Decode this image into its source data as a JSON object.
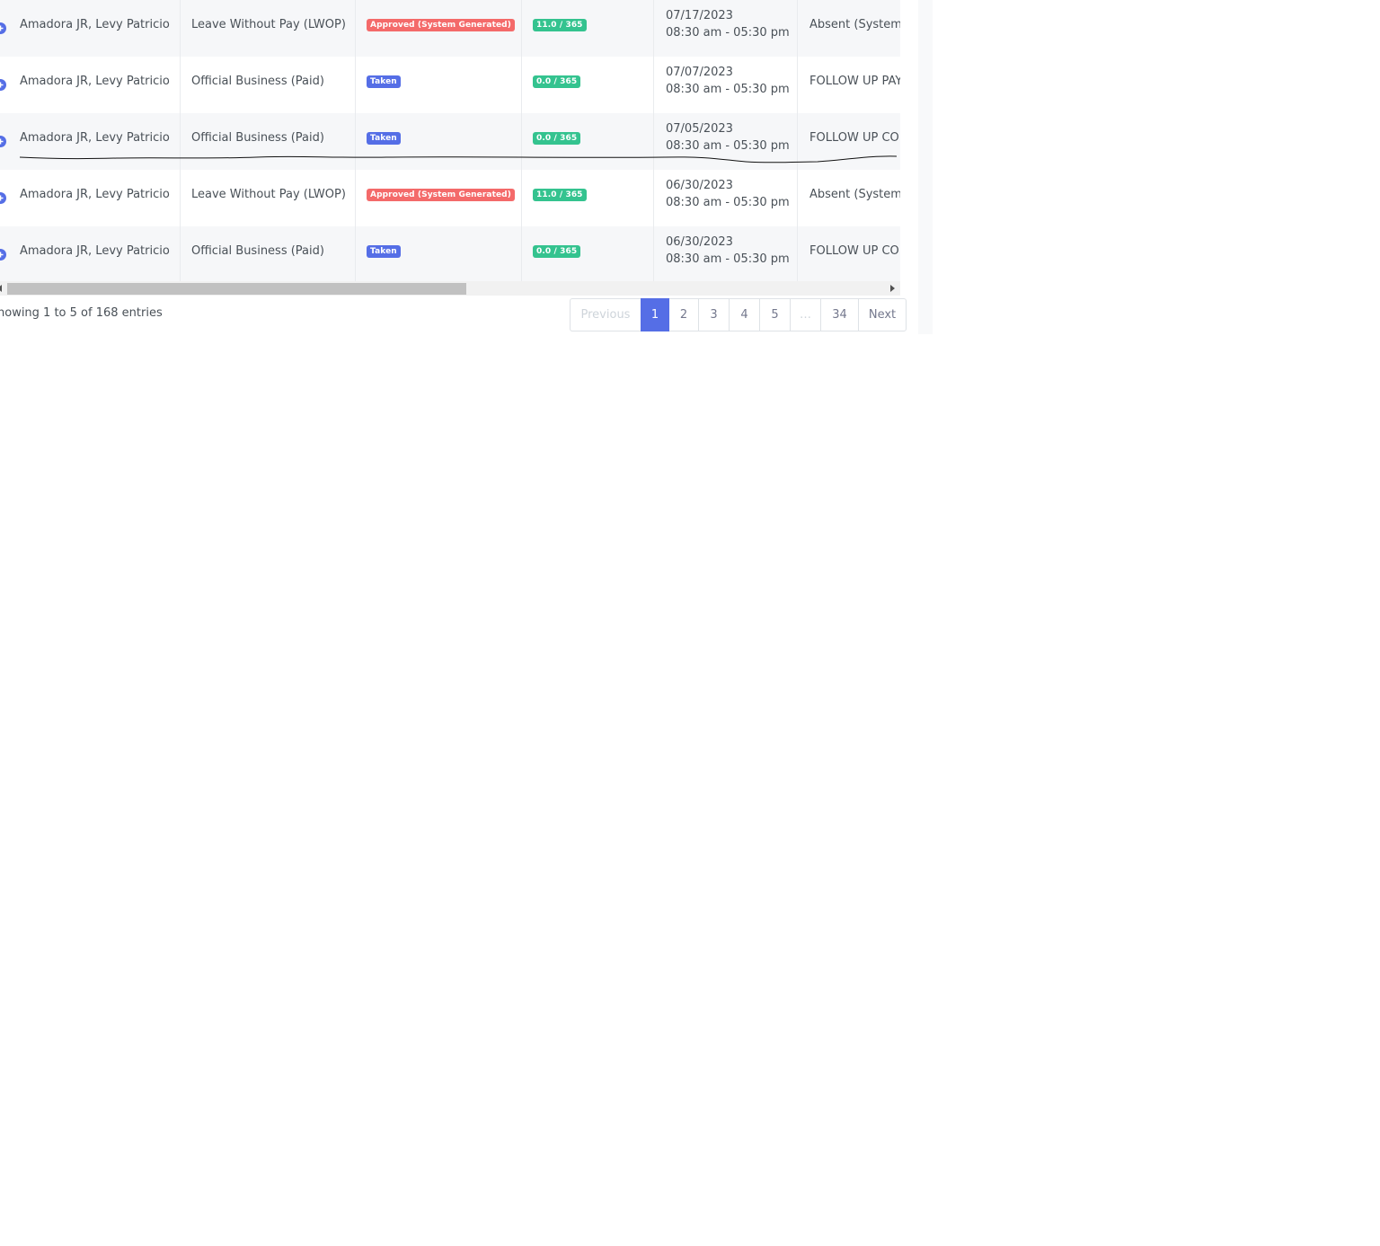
{
  "table": {
    "rows": [
      {
        "employee": "Amadora JR, Levy Patricio",
        "leave_type": "Leave Without Pay (LWOP)",
        "status": "Approved (System Generated)",
        "status_color": "#f46a6a",
        "balance": "11.0 / 365",
        "date": "07/17/2023",
        "time": "08:30 am - 05:30 pm",
        "reason": "Absent (System"
      },
      {
        "employee": "Amadora JR, Levy Patricio",
        "leave_type": "Official Business (Paid)",
        "status": "Taken",
        "status_color": "#556ee6",
        "balance": "0.0 / 365",
        "date": "07/07/2023",
        "time": "08:30 am - 05:30 pm",
        "reason": "FOLLOW UP PAYM"
      },
      {
        "employee": "Amadora JR, Levy Patricio",
        "leave_type": "Official Business (Paid)",
        "status": "Taken",
        "status_color": "#556ee6",
        "balance": "0.0 / 365",
        "date": "07/05/2023",
        "time": "08:30 am - 05:30 pm",
        "reason": "FOLLOW UP COLL"
      },
      {
        "employee": "Amadora JR, Levy Patricio",
        "leave_type": "Leave Without Pay (LWOP)",
        "status": "Approved (System Generated)",
        "status_color": "#f46a6a",
        "balance": "11.0 / 365",
        "date": "06/30/2023",
        "time": "08:30 am - 05:30 pm",
        "reason": "Absent (System"
      },
      {
        "employee": "Amadora JR, Levy Patricio",
        "leave_type": "Official Business (Paid)",
        "status": "Taken",
        "status_color": "#556ee6",
        "balance": "0.0 / 365",
        "date": "06/30/2023",
        "time": "08:30 am - 05:30 pm",
        "reason": "FOLLOW UP COLL"
      }
    ],
    "balance_color": "#34c38f"
  },
  "footer": {
    "entries_info": "howing 1 to 5 of 168 entries"
  },
  "pagination": {
    "previous": "Previous",
    "pages": [
      "1",
      "2",
      "3",
      "4",
      "5",
      "…",
      "34"
    ],
    "next": "Next",
    "active": "1"
  }
}
